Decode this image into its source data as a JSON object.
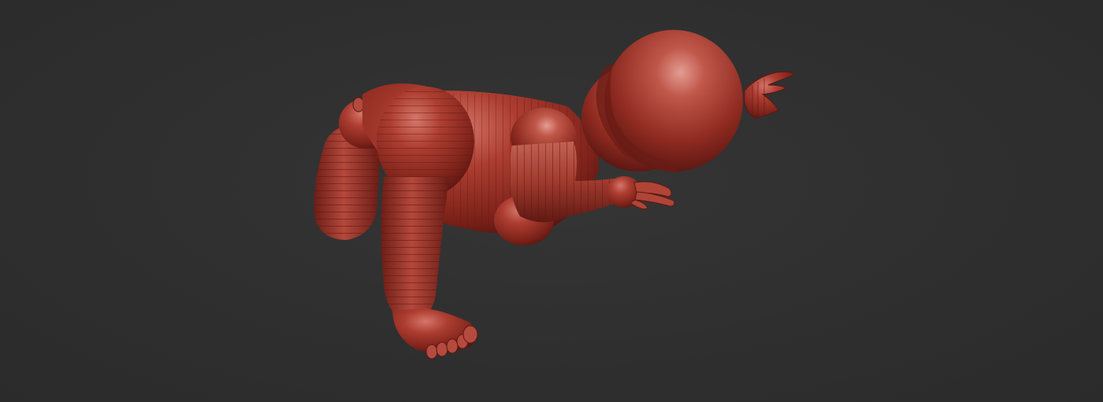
{
  "viewport": {
    "background_color": "#2f2f2f"
  },
  "model": {
    "subject": "baby-figure-sculpt",
    "material_color": "#a8382c",
    "material_highlight": "#d98a80",
    "material_shadow": "#5e1712"
  }
}
